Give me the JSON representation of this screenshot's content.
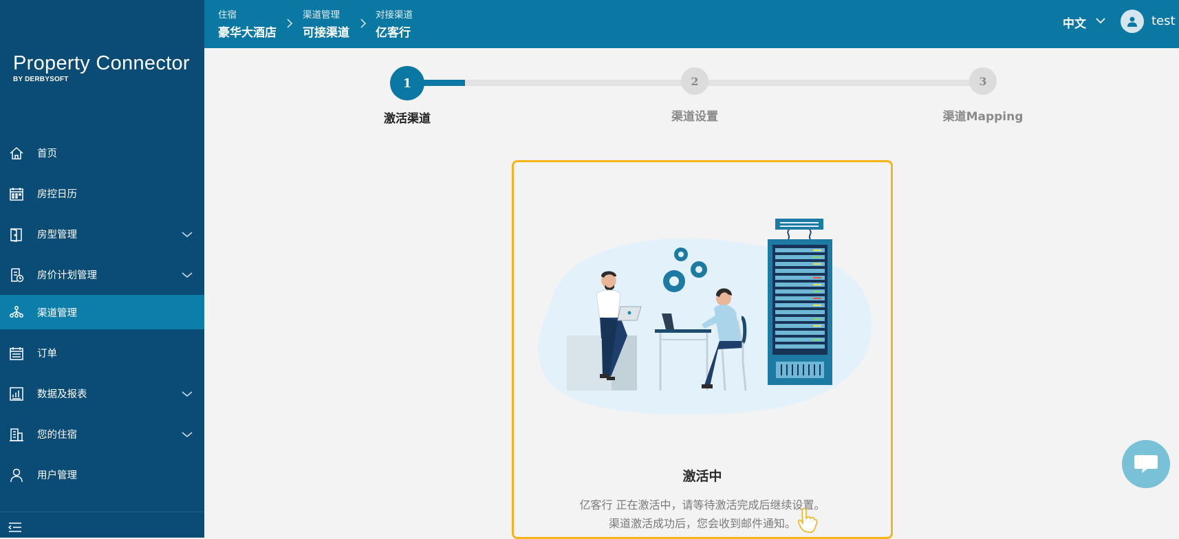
{
  "sidebar": {
    "logo": {
      "main": "Property Connector",
      "sub": "BY DERBYSOFT"
    },
    "items": [
      {
        "label": "首页",
        "icon": "home-icon",
        "has_children": false,
        "active": false
      },
      {
        "label": "房控日历",
        "icon": "calendar-icon",
        "has_children": false,
        "active": false
      },
      {
        "label": "房型管理",
        "icon": "door-icon",
        "has_children": true,
        "active": false
      },
      {
        "label": "房价计划管理",
        "icon": "rate-plan-icon",
        "has_children": true,
        "active": false
      },
      {
        "label": "渠道管理",
        "icon": "channel-icon",
        "has_children": false,
        "active": true
      },
      {
        "label": "订单",
        "icon": "order-icon",
        "has_children": false,
        "active": false
      },
      {
        "label": "数据及报表",
        "icon": "report-icon",
        "has_children": true,
        "active": false
      },
      {
        "label": "您的住宿",
        "icon": "building-icon",
        "has_children": true,
        "active": false
      },
      {
        "label": "用户管理",
        "icon": "user-icon",
        "has_children": false,
        "active": false
      }
    ],
    "collapse_icon": "collapse-menu-icon"
  },
  "header": {
    "breadcrumb": [
      {
        "top": "住宿",
        "bottom": "豪华大酒店"
      },
      {
        "top": "渠道管理",
        "bottom": "可接渠道"
      },
      {
        "top": "对接渠道",
        "bottom": "亿客行"
      }
    ],
    "language": "中文",
    "username": "test"
  },
  "stepper": {
    "steps": [
      {
        "number": "1",
        "label": "激活渠道",
        "active": true
      },
      {
        "number": "2",
        "label": "渠道设置",
        "active": false
      },
      {
        "number": "3",
        "label": "渠道Mapping",
        "active": false
      }
    ],
    "progress": 0.1
  },
  "card": {
    "title": "激活中",
    "message_line1": "亿客行 正在激活中，请等待激活完成后继续设置。",
    "message_line2": "渠道激活成功后，您会收到邮件通知。"
  },
  "colors": {
    "sidebar_bg": "#0a4c76",
    "topbar_bg": "#0b78a3",
    "active_item": "#0d7ea9",
    "card_border": "#f5b418"
  }
}
